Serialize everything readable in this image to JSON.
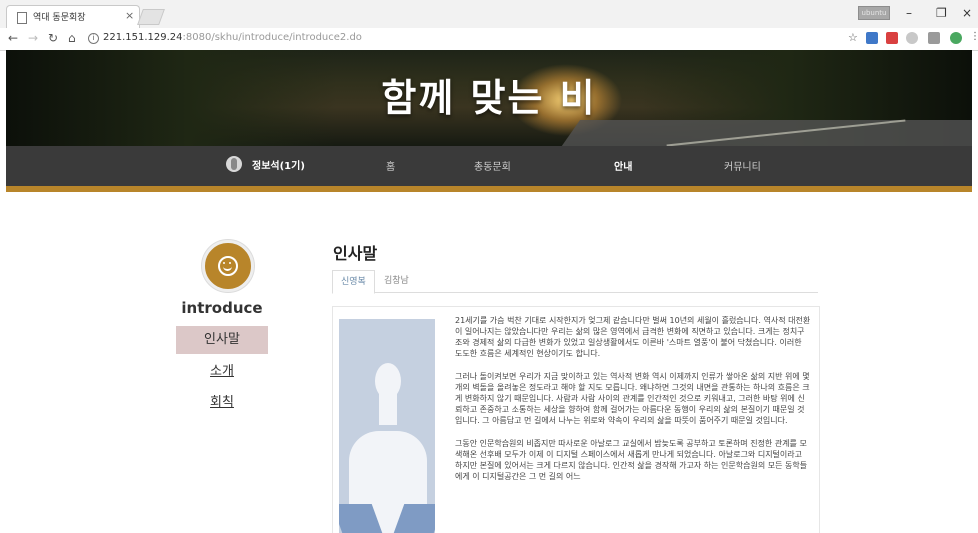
{
  "browser": {
    "tab_title": "역대 동문회장",
    "tab_close": "×",
    "url_host": "221.151.129.24",
    "url_rest": ":8080/skhu/introduce/introduce2.do",
    "user_chip": "ubuntu",
    "window_controls": {
      "minimize": "–",
      "maximize": "❐",
      "close": "×"
    }
  },
  "banner": {
    "title": "함께 맞는 비"
  },
  "nav": {
    "user_name": "정보석(1기)",
    "items": [
      "홈",
      "총동문회",
      "안내",
      "커뮤니티"
    ],
    "active": "안내"
  },
  "sidebar": {
    "title": "introduce",
    "items": [
      {
        "label": "인사말",
        "active": true
      },
      {
        "label": "소개",
        "active": false
      },
      {
        "label": "회칙",
        "active": false
      }
    ]
  },
  "content": {
    "title": "인사말",
    "tabs": [
      {
        "label": "신영복",
        "active": true
      },
      {
        "label": "김창남",
        "active": false
      }
    ],
    "paragraphs": [
      "21세기를 가슴 벅찬 기대로 시작한지가 엊그제 같습니다만 벌써 10년의 세월이 흘렀습니다. 역사적 대전환이 일어나지는 않았습니다만 우리는 삶의 많은 영역에서 급격한 변화에 직면하고 있습니다. 크게는 정치구조와 경제적 삶의 다급한 변화가 있었고 일상생활에서도 이른바 '스마트 열풍'이 불어 닥쳤습니다. 이러한 도도한 흐름은 세계적인 현상이기도 합니다.",
      "그러나 돌이켜보면 우리가 지금 맞이하고 있는 역사적 변화 역시 이제까지 인류가 쌓아온 삶의 지반 위에 몇 개의 벽돌을 올려놓은 정도라고 해야 할 지도 모릅니다. 왜냐하면 그것의 내면을 관통하는 하나의 흐름은 크게 변화하지 않기 때문입니다. 사람과 사람 사이의 관계를 인간적인 것으로 키워내고, 그러한 바탕 위에 신뢰하고 존중하고 소통하는 세상을 향하여 함께 걸어가는 아름다운 동행이 우리의 삶의 본질이기 때문일 것입니다. 그 아름답고 먼 길에서 나누는 위로와 약속이 우리의 삶을 따뜻이 품어주기 때문일 것입니다.",
      "그동안 인문학습원의 비좁지만 따사로운 아날로그 교실에서 밤늦도록 공부하고 토론하며 진정한 관계를 모색해온 선후배 모두가 이제 이 디지털 스페이스에서 새롭게 만나게 되었습니다. 아날로그와 디지털이라고 하지만 본질에 있어서는 크게 다르지 않습니다. 인간적 삶을 경작해 가고자 하는 인문학습원의 모든 동학들에게 이 디지털공간은 그 먼 길의 어느"
    ]
  }
}
